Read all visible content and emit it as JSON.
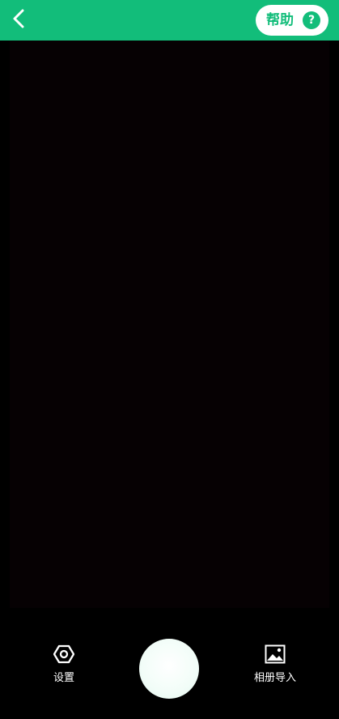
{
  "header": {
    "back_icon": "chevron-left-icon",
    "help_label": "帮助",
    "help_icon_glyph": "?",
    "background_color": "#12bd7a"
  },
  "camera": {
    "viewfinder_color": "#060103"
  },
  "controls": {
    "settings_label": "设置",
    "settings_icon": "hexagon-settings-icon",
    "shutter_icon": "shutter-button",
    "album_label": "相册导入",
    "album_icon": "image-icon"
  }
}
